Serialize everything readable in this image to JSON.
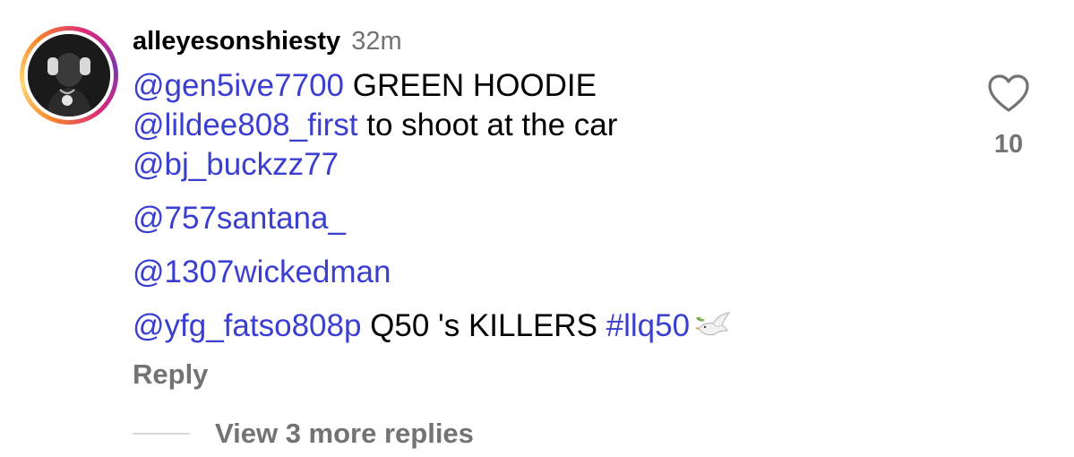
{
  "comment": {
    "username": "alleyesonshiesty",
    "time": "32m",
    "lines": [
      {
        "mention": "@gen5ive7700",
        "text": " GREEN HOODIE"
      },
      {
        "mention": "@lildee808_first",
        "text": " to shoot at the car"
      },
      {
        "mention": "@bj_buckzz77"
      },
      {
        "mention": "@757santana_"
      },
      {
        "mention": "@1307wickedman"
      },
      {
        "mention": "@yfg_fatso808p",
        "text": " Q50 's KILLERS ",
        "hashtag": "#llq50",
        "emoji": "dove-icon"
      }
    ],
    "reply_label": "Reply",
    "view_more_label": "View 3 more replies"
  },
  "like": {
    "icon": "heart-icon",
    "count": "10"
  },
  "colors": {
    "mention": "#3b3fd0",
    "secondary_text": "#737373",
    "story_ring_start": "#f58529",
    "story_ring_end": "#dd2a7b"
  }
}
